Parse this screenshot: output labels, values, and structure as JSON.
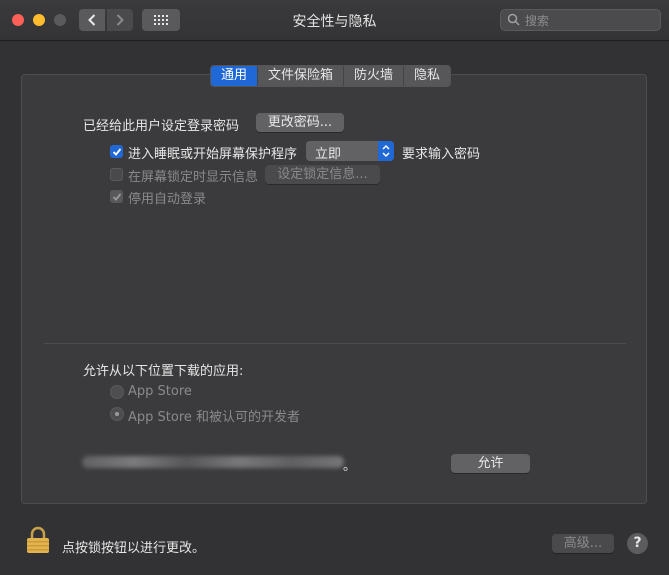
{
  "window": {
    "title": "安全性与隐私",
    "search_placeholder": "搜索"
  },
  "tabs": [
    {
      "label": "通用",
      "active": true
    },
    {
      "label": "文件保险箱",
      "active": false
    },
    {
      "label": "防火墙",
      "active": false
    },
    {
      "label": "隐私",
      "active": false
    }
  ],
  "general": {
    "password_label": "已经给此用户设定登录密码",
    "change_password_button": "更改密码...",
    "require_password": {
      "checked": true,
      "label": "进入睡眠或开始屏幕保护程序",
      "select_value": "立即",
      "suffix": "要求输入密码"
    },
    "lock_message": {
      "checked": false,
      "enabled": false,
      "label": "在屏幕锁定时显示信息",
      "button": "设定锁定信息..."
    },
    "disable_auto_login": {
      "checked": true,
      "enabled": false,
      "label": "停用自动登录"
    }
  },
  "downloads": {
    "heading": "允许从以下位置下载的应用:",
    "options": [
      {
        "label": "App Store",
        "selected": false
      },
      {
        "label": "App Store 和被认可的开发者",
        "selected": true
      }
    ],
    "blocked_message_tail": "。",
    "allow_button": "允许"
  },
  "footer": {
    "lock_text": "点按锁按钮以进行更改。",
    "advanced_button": "高级...",
    "help": "?"
  },
  "colors": {
    "accent": "#1f68d6",
    "window_bg": "#323234",
    "panel_bg": "#3b3b3d"
  }
}
